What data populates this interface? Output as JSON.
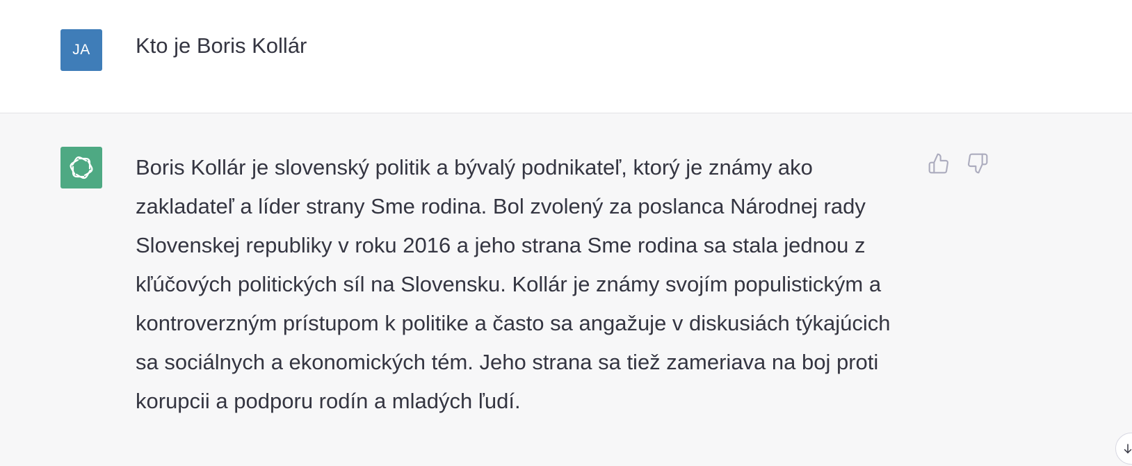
{
  "user_message": {
    "avatar_initials": "JA",
    "avatar_color": "#3f7db8",
    "text": "Kto je Boris Kollár"
  },
  "assistant_message": {
    "avatar_icon": "openai-logo-icon",
    "avatar_color": "#4ea983",
    "text": "Boris Kollár je slovenský politik a bývalý podnikateľ, ktorý je známy ako zakladateľ a líder strany Sme rodina. Bol zvolený za poslanca Národnej rady Slovenskej republiky v roku 2016 a jeho strana Sme rodina sa stala jednou z kľúčových politických síl na Slovensku. Kollár je známy svojím populistickým a kontroverzným prístupom k politike a často sa angažuje v diskusiách týkajúcich sa sociálnych a ekonomických tém. Jeho strana sa tiež zameriava na boj proti korupcii a podporu rodín a mladých ľudí.",
    "feedback_icons": [
      "thumbs-up-icon",
      "thumbs-down-icon"
    ]
  },
  "scroll_button_icon": "arrow-down-icon",
  "colors": {
    "text": "#343541",
    "assistant_bg": "#f7f7f8",
    "icon_gray": "#acacbe"
  }
}
